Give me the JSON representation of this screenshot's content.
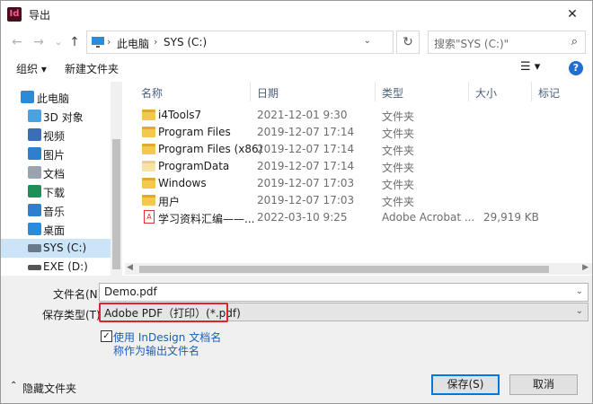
{
  "window": {
    "title": "导出",
    "app_icon": "Id",
    "close_glyph": "✕"
  },
  "nav": {
    "back_glyph": "←",
    "forward_glyph": "→",
    "history_glyph": "⌄",
    "up_glyph": "↑",
    "breadcrumb": [
      "此电脑",
      "SYS (C:)"
    ],
    "separator": "›",
    "dropdown_glyph": "⌄",
    "refresh_glyph": "↻",
    "search_placeholder": "搜索\"SYS (C:)\"",
    "search_glyph": "⌕"
  },
  "toolbar": {
    "organize": "组织 ▾",
    "new_folder": "新建文件夹",
    "view_glyph": "☰ ▾",
    "help": "?"
  },
  "sidebar": {
    "items": [
      {
        "label": "此电脑",
        "icon": "computer-icon",
        "color": "#2a8bd8"
      },
      {
        "label": "3D 对象",
        "icon": "cube-icon",
        "color": "#4aa3e0"
      },
      {
        "label": "视频",
        "icon": "video-icon",
        "color": "#3a6fb5"
      },
      {
        "label": "图片",
        "icon": "picture-icon",
        "color": "#2f7fce"
      },
      {
        "label": "文档",
        "icon": "document-icon",
        "color": "#9aa4b0"
      },
      {
        "label": "下载",
        "icon": "download-icon",
        "color": "#1f8f5a"
      },
      {
        "label": "音乐",
        "icon": "music-icon",
        "color": "#2e7fd0"
      },
      {
        "label": "桌面",
        "icon": "desktop-icon",
        "color": "#2a8bd8"
      },
      {
        "label": "SYS (C:)",
        "icon": "drive-icon",
        "color": "#6b7a8b"
      },
      {
        "label": "EXE (D:)",
        "icon": "drive-icon",
        "color": "#555555"
      }
    ]
  },
  "columns": {
    "name": "名称",
    "date": "日期",
    "type": "类型",
    "size": "大小",
    "tags": "标记",
    "sort_glyph": "⌃"
  },
  "files": [
    {
      "name": "i4Tools7",
      "date": "2021-12-01 9:30",
      "type": "文件夹",
      "size": "",
      "kind": "folder"
    },
    {
      "name": "Program Files",
      "date": "2019-12-07 17:14",
      "type": "文件夹",
      "size": "",
      "kind": "folder"
    },
    {
      "name": "Program Files (x86)",
      "date": "2019-12-07 17:14",
      "type": "文件夹",
      "size": "",
      "kind": "folder"
    },
    {
      "name": "ProgramData",
      "date": "2019-12-07 17:14",
      "type": "文件夹",
      "size": "",
      "kind": "folder"
    },
    {
      "name": "Windows",
      "date": "2019-12-07 17:03",
      "type": "文件夹",
      "size": "",
      "kind": "folder"
    },
    {
      "name": "用户",
      "date": "2019-12-07 17:03",
      "type": "文件夹",
      "size": "",
      "kind": "folder"
    },
    {
      "name": "学习资料汇编——...",
      "date": "2022-03-10 9:25",
      "type": "Adobe Acrobat ...",
      "size": "29,919 KB",
      "kind": "pdf"
    }
  ],
  "save": {
    "filename_label": "文件名(N):",
    "filename_value": "Demo.pdf",
    "type_label": "保存类型(T):",
    "type_value": "Adobe PDF（打印）(*.pdf)",
    "checkbox_label_1": "使用 InDesign 文档名",
    "checkbox_label_2": "称作为输出文件名",
    "checkbox_checked": true,
    "check_glyph": "✓",
    "hide_folders": "隐藏文件夹",
    "hide_glyph": "⌃",
    "save_button": "保存(S)",
    "cancel_button": "取消"
  },
  "colors": {
    "highlight": "#d9252b",
    "link": "#1b5fb5",
    "selected": "#cce4f7"
  }
}
